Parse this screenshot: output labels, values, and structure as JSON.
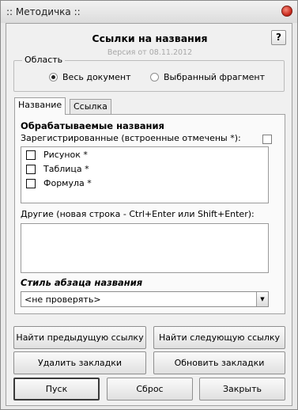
{
  "window": {
    "title": ":: Методичка ::"
  },
  "header": {
    "title": "Ссылки на названия",
    "version": "Версия от 08.11.2012",
    "help_label": "?"
  },
  "scope": {
    "legend": "Область",
    "options": [
      {
        "label": "Весь документ",
        "selected": true
      },
      {
        "label": "Выбранный фрагмент",
        "selected": false
      }
    ]
  },
  "tabs": [
    {
      "label": "Название",
      "active": true
    },
    {
      "label": "Ссылка",
      "active": false
    }
  ],
  "names_tab": {
    "section_title": "Обрабатываемые названия",
    "registered_label": "Зарегистрированные (встроенные отмечены *):",
    "registered_items": [
      {
        "label": "Рисунок *",
        "checked": false
      },
      {
        "label": "Таблица *",
        "checked": false
      },
      {
        "label": "Формула *",
        "checked": false
      }
    ],
    "other_label": "Другие (новая строка - Ctrl+Enter или Shift+Enter):",
    "other_value": "",
    "paragraph_style_label": "Стиль абзаца названия",
    "paragraph_style_value": "<не проверять>"
  },
  "buttons": {
    "find_prev": "Найти предыдущую ссылку",
    "find_next": "Найти следующую ссылку",
    "delete_bookmarks": "Удалить закладки",
    "update_bookmarks": "Обновить закладки",
    "start": "Пуск",
    "reset": "Сброс",
    "close": "Закрыть"
  }
}
